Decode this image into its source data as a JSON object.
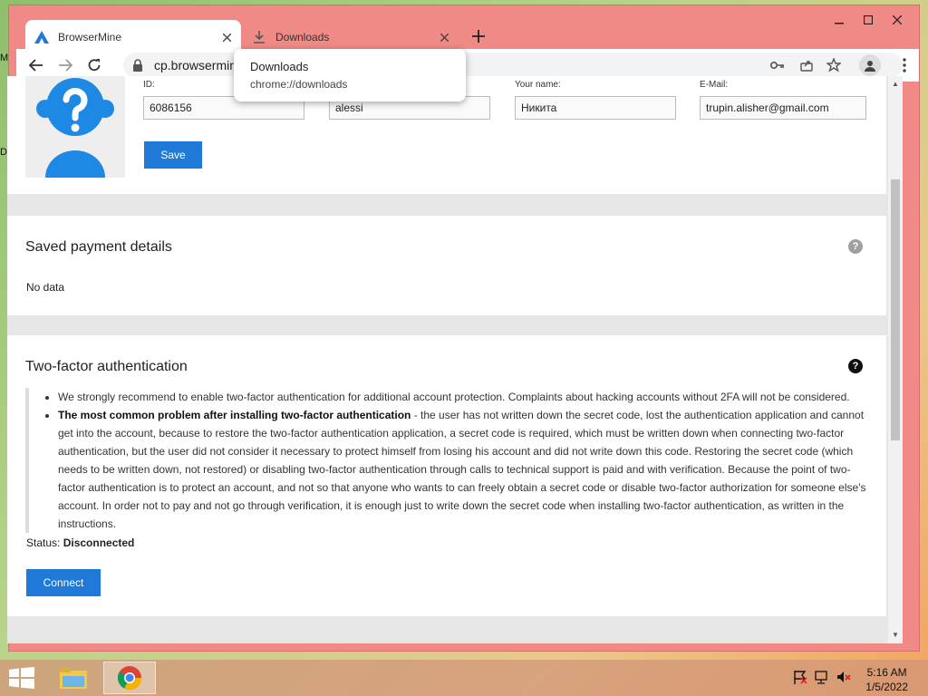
{
  "desktop": {
    "label_m": "M",
    "label_d": "D"
  },
  "browser": {
    "tabs": [
      {
        "title": "BrowserMine",
        "icon": "browsermine-logo-icon",
        "active": true
      },
      {
        "title": "Downloads",
        "icon": "download-icon",
        "active": false
      }
    ],
    "url": "cp.browsermine",
    "download_popup": {
      "title": "Downloads",
      "url": "chrome://downloads"
    }
  },
  "profile": {
    "fields": [
      {
        "label": "ID:",
        "value": "6086156"
      },
      {
        "label": "",
        "value": "alessi"
      },
      {
        "label": "Your name:",
        "value": "Никита"
      },
      {
        "label": "E-Mail:",
        "value": "trupin.alisher@gmail.com"
      }
    ],
    "save_label": "Save"
  },
  "payment": {
    "title": "Saved payment details",
    "empty_text": "No data"
  },
  "twofa": {
    "title": "Two-factor authentication",
    "note1": "We strongly recommend to enable two-factor authentication for additional account protection. Complaints about hacking accounts without 2FA will not be considered.",
    "note2_bold": "The most common problem after installing two-factor authentication",
    "note2_text": " - the user has not written down the secret code, lost the authentication application and cannot get into the account, because to restore the two-factor authentication application, a secret code is required, which must be written down when connecting two-factor authentication, but the user did not consider it necessary to protect himself from losing his account and did not write down this code. Restoring the secret code (which needs to be written down, not restored) or disabling two-factor authentication through calls to technical support is paid and with verification. Because the point of two-factor authentication is to protect an account, and not so that anyone who wants to can freely obtain a secret code or disable two-factor authorization for someone else's account. In order not to pay and not go through verification, it is enough just to write down the secret code when installing two-factor authentication, as written in the instructions.",
    "status_label": "Status:",
    "status_value": "Disconnected",
    "connect_label": "Connect"
  },
  "taskbar": {
    "time": "5:16 AM",
    "date": "1/5/2022"
  },
  "colors": {
    "accent": "#1e7ad6",
    "frame": "#ef8a86"
  }
}
